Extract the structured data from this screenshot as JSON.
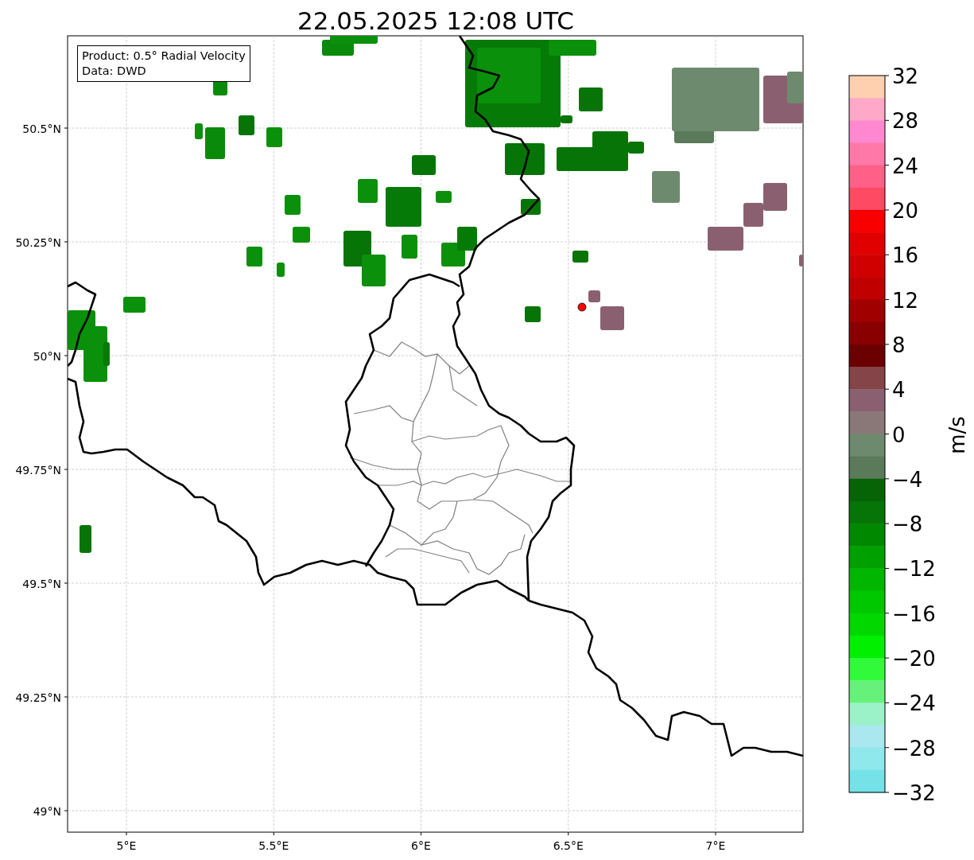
{
  "title": "22.05.2025 12:08 UTC",
  "info_box": {
    "lines": [
      "Product: 0.5° Radial Velocity",
      "Data: DWD"
    ]
  },
  "lat_ticks": [
    "50.5°N",
    "50.25°N",
    "50°N",
    "49.75°N",
    "49.5°N",
    "49.25°N",
    "49°N"
  ],
  "lon_ticks": [
    "5°E",
    "5.5°E",
    "6°E",
    "6.5°E",
    "7°E"
  ],
  "colorbar": {
    "label": "m/s",
    "ticks": [
      "32",
      "28",
      "24",
      "20",
      "16",
      "12",
      "8",
      "4",
      "0",
      "−4",
      "−8",
      "−12",
      "−16",
      "−20",
      "−24",
      "−28",
      "−32"
    ],
    "segments": [
      {
        "color": "#ffd0b0"
      },
      {
        "color": "#ffa8c8"
      },
      {
        "color": "#ff88d0"
      },
      {
        "color": "#ff78a8"
      },
      {
        "color": "#ff6088"
      },
      {
        "color": "#ff4a64"
      },
      {
        "color": "#f80000"
      },
      {
        "color": "#e00000"
      },
      {
        "color": "#d00000"
      },
      {
        "color": "#c00000"
      },
      {
        "color": "#a00000"
      },
      {
        "color": "#880000"
      },
      {
        "color": "#6a0000"
      },
      {
        "color": "#844448"
      },
      {
        "color": "#8a6070"
      },
      {
        "color": "#8a7878"
      },
      {
        "color": "#6e8a6e"
      },
      {
        "color": "#5a7a5a"
      },
      {
        "color": "#066306"
      },
      {
        "color": "#067406"
      },
      {
        "color": "#008800"
      },
      {
        "color": "#00a000"
      },
      {
        "color": "#00b600"
      },
      {
        "color": "#00c800"
      },
      {
        "color": "#00d800"
      },
      {
        "color": "#00f000"
      },
      {
        "color": "#30fa3a"
      },
      {
        "color": "#66f27a"
      },
      {
        "color": "#9cf2c8"
      },
      {
        "color": "#a8e8ee"
      },
      {
        "color": "#8ee8ec"
      },
      {
        "color": "#75e2e8"
      }
    ]
  }
}
